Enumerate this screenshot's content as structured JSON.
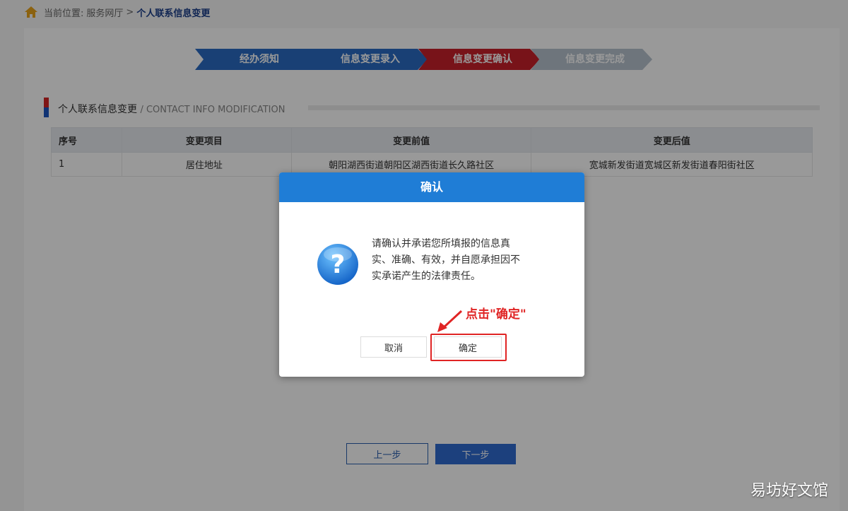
{
  "breadcrumb": {
    "prefix": "当前位置:",
    "parent": "服务网厅",
    "separator": ">",
    "current": "个人联系信息变更"
  },
  "steps": [
    {
      "label": "经办须知",
      "state": "done"
    },
    {
      "label": "信息变更录入",
      "state": "done"
    },
    {
      "label": "信息变更确认",
      "state": "active"
    },
    {
      "label": "信息变更完成",
      "state": "pending"
    }
  ],
  "section": {
    "title": "个人联系信息变更",
    "subtitle": "/ CONTACT INFO MODIFICATION"
  },
  "table": {
    "headers": [
      "序号",
      "变更项目",
      "变更前值",
      "变更后值"
    ],
    "rows": [
      [
        "1",
        "居住地址",
        "朝阳湖西街道朝阳区湖西街道长久路社区",
        "宽城新发街道宽城区新发街道春阳街社区"
      ]
    ]
  },
  "nav": {
    "prev_label": "上一步",
    "next_label": "下一步"
  },
  "dialog": {
    "title": "确认",
    "message": "请确认并承诺您所填报的信息真实、准确、有效，并自愿承担因不实承诺产生的法律责任。",
    "cancel_label": "取消",
    "ok_label": "确定",
    "annotation": "点击\"确定\""
  },
  "watermark": "易坊好文馆",
  "colors": {
    "step_done": "#2b6cc4",
    "step_active": "#c8202a",
    "step_pending": "#b8c3cf",
    "dialog_header": "#1f7dd6",
    "annotation_red": "#e02424",
    "breadcrumb_current": "#1b3f8a"
  },
  "icons": {
    "home": "home-icon",
    "question": "question-icon",
    "arrow": "annotation-arrow-icon"
  }
}
